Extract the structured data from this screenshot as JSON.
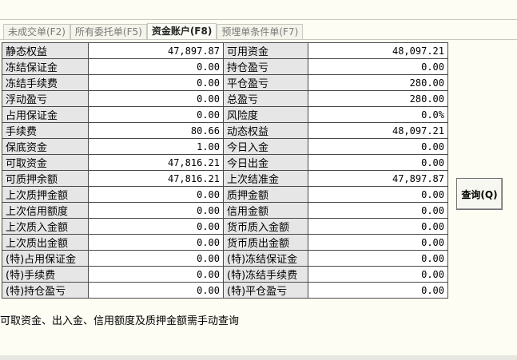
{
  "tabs": [
    {
      "label": "未成交单(F2)",
      "active": false
    },
    {
      "label": "所有委托单(F5)",
      "active": false
    },
    {
      "label": "资金账户(F8)",
      "active": true
    },
    {
      "label": "预埋单条件单(F7)",
      "active": false
    }
  ],
  "account_rows": [
    {
      "left_label": "静态权益",
      "left_value": "47,897.87",
      "right_label": "可用资金",
      "right_value": "48,097.21"
    },
    {
      "left_label": "冻结保证金",
      "left_value": "0.00",
      "right_label": "持仓盈亏",
      "right_value": "0.00"
    },
    {
      "left_label": "冻结手续费",
      "left_value": "0.00",
      "right_label": "平仓盈亏",
      "right_value": "280.00"
    },
    {
      "left_label": "浮动盈亏",
      "left_value": "0.00",
      "right_label": "总盈亏",
      "right_value": "280.00"
    },
    {
      "left_label": "占用保证金",
      "left_value": "0.00",
      "right_label": "风险度",
      "right_value": "0.0%"
    },
    {
      "left_label": "手续费",
      "left_value": "80.66",
      "right_label": "动态权益",
      "right_value": "48,097.21"
    },
    {
      "left_label": "保底资金",
      "left_value": "1.00",
      "right_label": "今日入金",
      "right_value": "0.00"
    },
    {
      "left_label": "可取资金",
      "left_value": "47,816.21",
      "right_label": "今日出金",
      "right_value": "0.00"
    },
    {
      "left_label": "可质押余额",
      "left_value": "47,816.21",
      "right_label": "上次结准金",
      "right_value": "47,897.87"
    },
    {
      "left_label": "上次质押金额",
      "left_value": "0.00",
      "right_label": "质押金额",
      "right_value": "0.00"
    },
    {
      "left_label": "上次信用额度",
      "left_value": "0.00",
      "right_label": "信用金额",
      "right_value": "0.00"
    },
    {
      "left_label": "上次质入金额",
      "left_value": "0.00",
      "right_label": "货币质入金额",
      "right_value": "0.00"
    },
    {
      "left_label": "上次质出金额",
      "left_value": "0.00",
      "right_label": "货币质出金额",
      "right_value": "0.00"
    },
    {
      "left_label": "(特)占用保证金",
      "left_value": "0.00",
      "right_label": "(特)冻结保证金",
      "right_value": "0.00"
    },
    {
      "left_label": "(特)手续费",
      "left_value": "0.00",
      "right_label": "(特)冻结手续费",
      "right_value": "0.00"
    },
    {
      "left_label": "(特)持仓盈亏",
      "left_value": "0.00",
      "right_label": "(特)平仓盈亏",
      "right_value": "0.00"
    }
  ],
  "query_button_label": "查询(Q)",
  "note": "可取资金、出入金、信用额度及质押金额需手动查询"
}
